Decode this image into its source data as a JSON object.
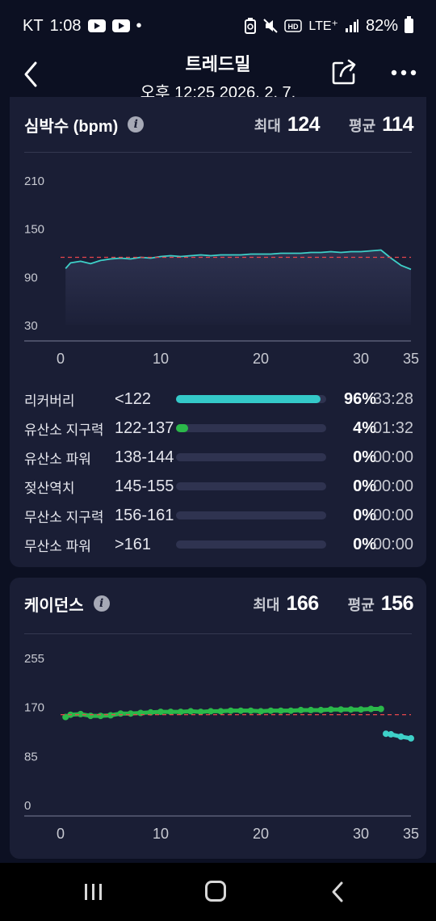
{
  "status_bar": {
    "carrier": "KT",
    "time": "1:08",
    "network": "LTE⁺",
    "battery": "82%"
  },
  "header": {
    "title": "트레드밀",
    "subtitle": "오후 12:25 2026. 2. 7."
  },
  "heart_rate": {
    "title": "심박수 (bpm)",
    "max_label": "최대",
    "max_value": "124",
    "avg_label": "평균",
    "avg_value": "114"
  },
  "cadence": {
    "title": "케이던스",
    "max_label": "최대",
    "max_value": "166",
    "avg_label": "평균",
    "avg_value": "156"
  },
  "zones": [
    {
      "name": "리커버리",
      "range": "<122",
      "pct": "96%",
      "time": "33:28",
      "fraction": 0.96,
      "color": "#34c9c9"
    },
    {
      "name": "유산소 지구력",
      "range": "122-137",
      "pct": "4%",
      "time": "01:32",
      "fraction": 0.08,
      "color": "#2bb84a"
    },
    {
      "name": "유산소 파워",
      "range": "138-144",
      "pct": "0%",
      "time": "00:00",
      "fraction": 0,
      "color": "#e0c030"
    },
    {
      "name": "젖산역치",
      "range": "145-155",
      "pct": "0%",
      "time": "00:00",
      "fraction": 0,
      "color": "#f08a2c"
    },
    {
      "name": "무산소 지구력",
      "range": "156-161",
      "pct": "0%",
      "time": "00:00",
      "fraction": 0,
      "color": "#e8463c"
    },
    {
      "name": "무산소 파워",
      "range": ">161",
      "pct": "0%",
      "time": "00:00",
      "fraction": 0,
      "color": "#c02060"
    }
  ],
  "chart_data": [
    {
      "type": "line",
      "title": "심박수 (bpm)",
      "ylim": [
        30,
        210
      ],
      "y_ticks": [
        "210",
        "150",
        "90",
        "30"
      ],
      "xlim": [
        0,
        35
      ],
      "x_ticks": [
        "0",
        "10",
        "20",
        "30",
        "35"
      ],
      "average_line": 114,
      "series": [
        {
          "color": "#3ed0c8",
          "x": [
            0.5,
            1,
            2,
            3,
            4,
            5,
            6,
            7,
            8,
            9,
            10,
            11,
            12,
            13,
            14,
            15,
            16,
            17,
            18,
            19,
            20,
            21,
            22,
            23,
            24,
            25,
            26,
            27,
            28,
            29,
            30,
            31,
            32,
            33,
            34,
            35
          ],
          "y": [
            100,
            107,
            109,
            106,
            110,
            112,
            113,
            112,
            114,
            113,
            115,
            116,
            115,
            116,
            117,
            116,
            117,
            117,
            117,
            118,
            118,
            118,
            119,
            119,
            119,
            120,
            120,
            121,
            120,
            121,
            121,
            122,
            123,
            113,
            104,
            99
          ]
        }
      ]
    },
    {
      "type": "scatter",
      "title": "케이던스",
      "ylim": [
        0,
        255
      ],
      "y_ticks": [
        "255",
        "170",
        "85",
        "0"
      ],
      "xlim": [
        0,
        35
      ],
      "x_ticks": [
        "0",
        "10",
        "20",
        "30",
        "35"
      ],
      "average_line": 156,
      "series": [
        {
          "color": "#2bb84a",
          "x": [
            0.5,
            1,
            2,
            3,
            4,
            5,
            6,
            7,
            8,
            9,
            10,
            11,
            12,
            13,
            14,
            15,
            16,
            17,
            18,
            19,
            20,
            21,
            22,
            23,
            24,
            25,
            26,
            27,
            28,
            29,
            30,
            31,
            32
          ],
          "y": [
            152,
            156,
            157,
            154,
            154,
            155,
            158,
            158,
            159,
            160,
            161,
            161,
            161,
            162,
            161,
            162,
            162,
            163,
            163,
            163,
            162,
            163,
            163,
            163,
            164,
            164,
            164,
            165,
            165,
            165,
            165,
            166,
            166
          ]
        },
        {
          "color": "#3ed0c8",
          "x": [
            32.5,
            33,
            34,
            35
          ],
          "y": [
            123,
            122,
            118,
            115
          ]
        }
      ]
    }
  ]
}
